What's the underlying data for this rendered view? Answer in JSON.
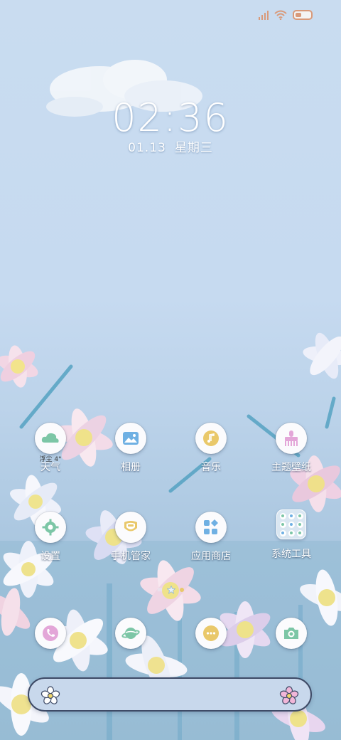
{
  "status": {
    "icons": [
      "signal-icon",
      "wifi-icon",
      "battery-icon"
    ]
  },
  "clock": {
    "time": "02:36",
    "date": "01.13",
    "weekday": "星期三"
  },
  "apps_row1": [
    {
      "label": "天气",
      "icon": "weather-cloud-icon",
      "sub": "浮尘 4°"
    },
    {
      "label": "相册",
      "icon": "gallery-icon"
    },
    {
      "label": "音乐",
      "icon": "music-note-icon"
    },
    {
      "label": "主题壁纸",
      "icon": "theme-brush-icon"
    }
  ],
  "apps_row2": [
    {
      "label": "设置",
      "icon": "settings-gear-icon"
    },
    {
      "label": "手机管家",
      "icon": "security-shield-icon"
    },
    {
      "label": "应用商店",
      "icon": "app-store-icon"
    },
    {
      "label": "系统工具",
      "icon": "folder-icon"
    }
  ],
  "dock": [
    {
      "icon": "phone-icon"
    },
    {
      "icon": "browser-planet-icon"
    },
    {
      "icon": "messages-icon"
    },
    {
      "icon": "camera-icon"
    }
  ],
  "search": {
    "left_icon": "flower-icon",
    "right_icon": "flower-icon"
  },
  "colors": {
    "accent_green": "#7cc6a6",
    "accent_yellow": "#e9c86a",
    "accent_pink": "#e3a6d8",
    "accent_blue": "#6fb0e3"
  }
}
